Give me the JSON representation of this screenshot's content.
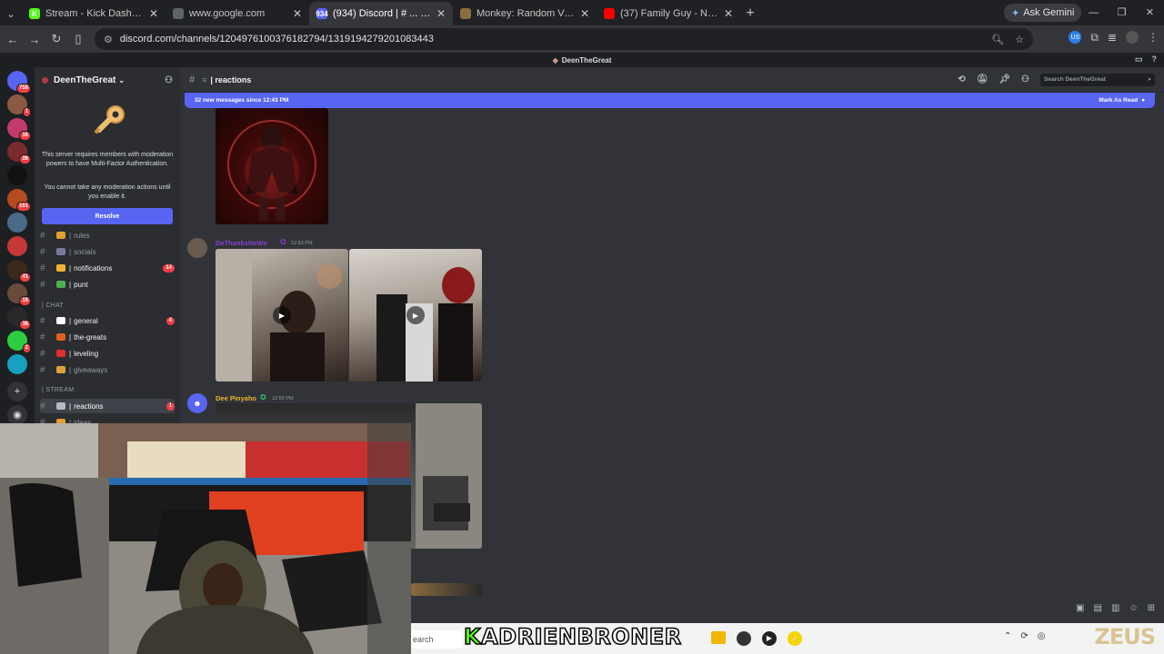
{
  "browser": {
    "tabs": [
      {
        "title": "Stream - Kick Dashboard",
        "favicon": "kick-icon",
        "fav_color": "#53fc18",
        "fav_text": "K"
      },
      {
        "title": "www.google.com",
        "favicon": "globe-icon",
        "fav_color": "#5f6368",
        "fav_text": ""
      },
      {
        "title": "(934) Discord | # ... | reactions",
        "favicon": "discord-icon",
        "fav_color": "#5865f2",
        "fav_text": "934",
        "active": true
      },
      {
        "title": "Monkey: Random Video Chat |",
        "favicon": "monkey-icon",
        "fav_color": "#8d6e3f",
        "fav_text": ""
      },
      {
        "title": "(37) Family Guy - No Diabeto",
        "favicon": "youtube-icon",
        "fav_color": "#ff0000",
        "fav_text": ""
      }
    ],
    "gemini_label": "Ask Gemini",
    "url": "discord.com/channels/1204976100376182794/1319194279201083443"
  },
  "discord": {
    "window_title": "DeenTheGreat",
    "server_name": "DeenTheGreat",
    "servers": [
      {
        "badge": "758",
        "color": "#5865f2"
      },
      {
        "badge": "1",
        "color": "#8a5a44"
      },
      {
        "badge": "16",
        "color": "#c23b6a"
      },
      {
        "badge": "26",
        "color": "#7a2b2b"
      },
      {
        "badge": "",
        "color": "#111111"
      },
      {
        "badge": "161",
        "color": "#b54b1f"
      },
      {
        "badge": "",
        "color": "#4a6a8a"
      },
      {
        "badge": "",
        "color": "#c63737"
      },
      {
        "badge": "41",
        "color": "#3a2a1a"
      },
      {
        "badge": "19",
        "color": "#6a4a3a"
      },
      {
        "badge": "38",
        "color": "#2a2a2a"
      },
      {
        "badge": "2",
        "color": "#2ecc40"
      },
      {
        "badge": "",
        "color": "#18a0c0"
      }
    ],
    "mfa": {
      "line1": "This server requires members with moderation powers to have Multi-Factor Authentication.",
      "line2": "You cannot take any moderation actions until you enable it.",
      "resolve": "Resolve"
    },
    "channels_top": [
      {
        "name": "rules",
        "icon_color": "#e0a030",
        "bright": false
      },
      {
        "name": "socials",
        "icon_color": "#7a7aa0",
        "bright": false
      },
      {
        "name": "notifications",
        "icon_color": "#f0b232",
        "bright": true,
        "count": "14"
      },
      {
        "name": "punt",
        "icon_color": "#4caf50",
        "bright": true
      }
    ],
    "cat_chat": "| CHAT",
    "channels_chat": [
      {
        "name": "general",
        "icon_color": "#ffffff",
        "bright": true,
        "count": "4"
      },
      {
        "name": "the-greats",
        "icon_color": "#e06020",
        "bright": true
      },
      {
        "name": "leveling",
        "icon_color": "#e03030",
        "bright": true
      },
      {
        "name": "giveaways",
        "icon_color": "#e0a040",
        "bright": false
      }
    ],
    "cat_stream": "| STREAM",
    "channels_stream": [
      {
        "name": "reactions",
        "icon_color": "#b5bac1",
        "bright": true,
        "count": "1",
        "selected": true
      },
      {
        "name": "ideas",
        "icon_color": "#e0a030",
        "bright": false
      }
    ],
    "channel_header": "| reactions",
    "search_placeholder": "Search DeenTheGreat",
    "new_messages": "32 new messages since 12:43 PM",
    "mark_as_read": "Mark As Read",
    "messages": [
      {
        "author": "DeThanksNeWe",
        "author_color": "#8a3fd0",
        "time": "12:53 PM"
      },
      {
        "author": "Dee Pinyaho",
        "author_color": "#f0b232",
        "time": "12:55 PM"
      }
    ]
  },
  "overlay": {
    "kick_username_k": "K",
    "kick_username": "ADRIENBRONER",
    "brand": "ZEUS",
    "taskbar_search": "earch"
  }
}
